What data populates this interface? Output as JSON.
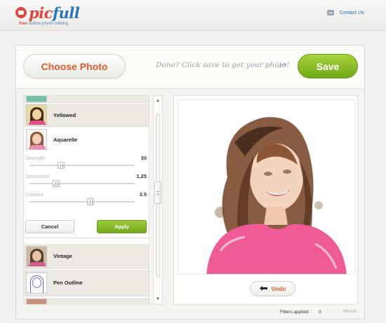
{
  "header": {
    "logo_part1": "pic",
    "logo_part2": "full",
    "tagline_free": "free",
    "tagline_rest": " online photo editing",
    "contact_label": "Contact Us",
    "contact_icon": "mail-icon"
  },
  "toolbar": {
    "choose_label": "Choose Photo",
    "hint_text": "Done? Click save to get your photo!",
    "save_label": "Save"
  },
  "filters": {
    "items": [
      {
        "label": "Yellowed"
      },
      {
        "label": "Aquarelle"
      },
      {
        "label": "Vintage"
      },
      {
        "label": "Pen Outline"
      }
    ],
    "active": {
      "name": "Aquarelle",
      "params": [
        {
          "label": "Strength",
          "value": "30",
          "level": 0.3
        },
        {
          "label": "Saturation",
          "value": "1.25",
          "level": 0.25
        },
        {
          "label": "Contour",
          "value": "3.5",
          "level": 0.58
        }
      ],
      "cancel_label": "Cancel",
      "apply_label": "Apply"
    }
  },
  "scrollbar": {
    "up_glyph": "▲",
    "down_glyph": "▼"
  },
  "preview": {
    "undo_label": "Undo"
  },
  "status": {
    "filters_applied_label": "Filters applied :",
    "filters_applied_count": "0",
    "credit": "©PicFull"
  },
  "colors": {
    "accent_orange": "#e2592b",
    "save_green": "#8cc22f",
    "logo_red": "#e0473f",
    "logo_blue": "#2b75b9"
  }
}
